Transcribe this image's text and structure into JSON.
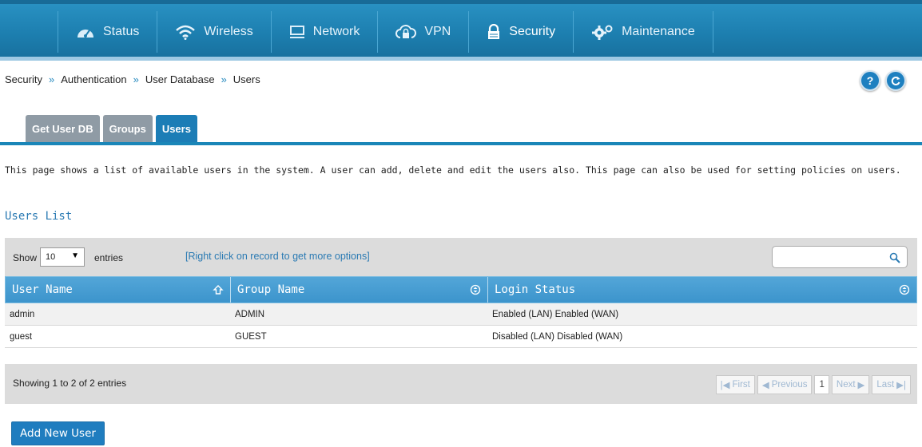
{
  "nav": {
    "items": [
      {
        "label": "Status",
        "icon": "speedometer-icon"
      },
      {
        "label": "Wireless",
        "icon": "wifi-icon"
      },
      {
        "label": "Network",
        "icon": "monitor-icon"
      },
      {
        "label": "VPN",
        "icon": "cloud-lock-icon"
      },
      {
        "label": "Security",
        "icon": "padlock-icon",
        "active": true
      },
      {
        "label": "Maintenance",
        "icon": "gears-icon"
      }
    ]
  },
  "breadcrumb": {
    "items": [
      "Security",
      "Authentication",
      "User Database",
      "Users"
    ],
    "separator": "»"
  },
  "help_button": {
    "label": "?"
  },
  "refresh_button": {
    "icon": "refresh-icon"
  },
  "tabs": [
    {
      "label": "Get User DB"
    },
    {
      "label": "Groups"
    },
    {
      "label": "Users",
      "active": true
    }
  ],
  "description": "This page shows a list of available users in the system. A user can add, delete and edit the users also. This page can also be used for setting policies on users.",
  "section_title": "Users List",
  "controls": {
    "show_label": "Show",
    "entries_value": "10",
    "entries_label": "entries",
    "right_click_note": "[Right click on record to get more options]",
    "search_placeholder": ""
  },
  "table": {
    "columns": [
      "User Name",
      "Group Name",
      "Login Status"
    ],
    "rows": [
      [
        "admin",
        "ADMIN",
        "Enabled (LAN) Enabled (WAN)"
      ],
      [
        "guest",
        "GUEST",
        "Disabled (LAN) Disabled (WAN)"
      ]
    ]
  },
  "footer": {
    "info": "Showing 1 to 2 of 2 entries",
    "pager": {
      "first": "First",
      "previous": "Previous",
      "current": "1",
      "next": "Next",
      "last": "Last"
    }
  },
  "add_button": {
    "label": "Add New User"
  },
  "colors": {
    "nav_bg": "#1d7fb0",
    "accent": "#1c7db6",
    "link": "#2a7ab3",
    "table_header": "#469cd2"
  }
}
